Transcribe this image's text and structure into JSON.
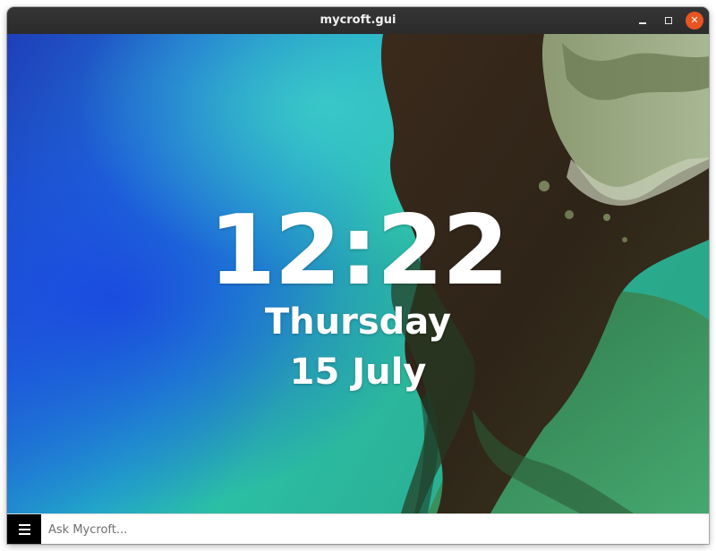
{
  "window": {
    "title": "mycroft.gui",
    "controls": {
      "minimize_icon": "minimize-icon",
      "maximize_icon": "maximize-icon",
      "close_icon": "close-icon",
      "close_symbol": "✕",
      "close_color": "#e95420"
    }
  },
  "clock": {
    "time": "12:22",
    "day": "Thursday",
    "date": "15 July"
  },
  "bottom_bar": {
    "menu_icon": "hamburger-menu-icon",
    "input_placeholder": "Ask Mycroft...",
    "input_value": ""
  },
  "colors": {
    "titlebar": "#2c2c2c",
    "menu_button": "#000000",
    "clock_text": "#ffffff"
  }
}
